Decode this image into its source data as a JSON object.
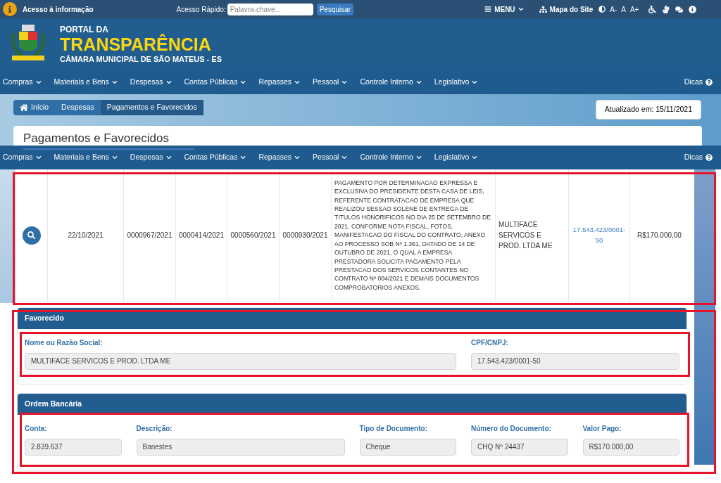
{
  "topbar": {
    "access_label": "Acesso à informação",
    "quick_label": "Acesso Rápido:",
    "search_placeholder": "Palavra-chave...",
    "search_button": "Pesquisar",
    "menu": "MENU",
    "sitemap": "Mapa do Site",
    "font_controls": [
      "A-",
      "A",
      "A+"
    ]
  },
  "header": {
    "pre": "PORTAL DA",
    "title": "TRANSPARÊNCIA",
    "subtitle": "CÂMARA MUNICIPAL DE SÃO MATEUS - ES"
  },
  "nav": [
    "Compras",
    "Materiais e Bens",
    "Despesas",
    "Contas Públicas",
    "Repasses",
    "Pessoal",
    "Controle Interno",
    "Legislativo"
  ],
  "nav_tips": "Dicas",
  "breadcrumb": [
    {
      "label": "Início",
      "selected": false
    },
    {
      "label": "Despesas",
      "selected": false
    },
    {
      "label": "Pagamentos e Favorecidos",
      "selected": true
    }
  ],
  "updated": "Atualizado em: 15/11/2021",
  "page_title": "Pagamentos e Favorecidos",
  "nav_second": [
    "Compras",
    "Materiais e Bens",
    "Despesas",
    "Contas Públicas",
    "Repasses",
    "Pessoal",
    "Controle Interno",
    "Legislativo"
  ],
  "nav_second_tips": "Dicas",
  "table": {
    "rows": [
      {
        "date": "22/10/2021",
        "col_3": "0000967/2021",
        "col_4": "0000414/2021",
        "col_5": "0000560/2021",
        "col_6": "0000930/2021",
        "description": "PAGAMENTO POR DETERMINACAO EXPRESSA E EXCLUSIVA DO PRESIDENTE DESTA CASA DE LEIS, REFERENTE CONTRATACAO DE EMPRESA QUE REALIZOU SESSAO SOLENE DE ENTREGA DE TITULOS HONORIFICOS NO DIA 25 DE SETEMBRO DE 2021, CONFORME NOTA FISCAL, FOTOS, MANIFESTACAO DO FISCAL DO CONTRATO, ANEXO AO PROCESSO SOB Nº 1.361, DATADO DE 14 DE OUTUBRO DE 2021, O QUAL A EMPRESA PRESTADORA SOLICITA PAGAMENTO PELA PRESTACAO DOS SERVICOS CONTANTES NO CONTRATO Nº 004/2021 E DEMAIS DOCUMENTOS COMPROBATORIOS ANEXOS.",
        "name": "MULTIFACE SERVICOS E PROD. LTDA ME",
        "cnpj": "17.543.423/0001-50",
        "value": "R$170.000,00"
      }
    ]
  },
  "sections": [
    {
      "title": "Favorecido",
      "fields": [
        {
          "label": "Nome ou Razão Social:",
          "value": "MULTIFACE SERVICOS E PROD. LTDA ME"
        },
        {
          "label": "CPF/CNPJ:",
          "value": "17.543.423/0001-50"
        }
      ]
    },
    {
      "title": "Ordem Bancária",
      "fields": [
        {
          "label": "Conta:",
          "value": "2.839.637"
        },
        {
          "label": "Descrição:",
          "value": "Banestes"
        },
        {
          "label": "Tipo de Documento:",
          "value": "Cheque"
        },
        {
          "label": "Número do Documento:",
          "value": "CHQ Nº 24437"
        },
        {
          "label": "Valor Pago:",
          "value": "R$170.000,00"
        }
      ]
    }
  ]
}
